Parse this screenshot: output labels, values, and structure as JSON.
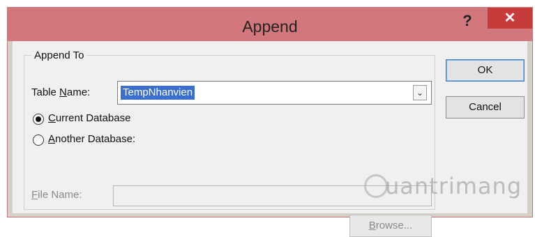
{
  "window": {
    "title": "Append",
    "help_glyph": "?",
    "close_glyph": "✕"
  },
  "group": {
    "legend": "Append To"
  },
  "table_name": {
    "label": "Table Name:",
    "value": "TempNhanvien",
    "dropdown_icon": "chevron-down-icon"
  },
  "options": {
    "current_db": {
      "label": "Current Database",
      "selected": true
    },
    "another_db": {
      "label": "Another Database:",
      "selected": false
    }
  },
  "file_name": {
    "label": "File Name:",
    "value": ""
  },
  "buttons": {
    "browse": "Browse...",
    "ok": "OK",
    "cancel": "Cancel"
  },
  "watermark": {
    "text": "uantrimang"
  },
  "colors": {
    "titlebar": "#d2777c",
    "close": "#c73b3b",
    "selection": "#3a6fcf"
  }
}
